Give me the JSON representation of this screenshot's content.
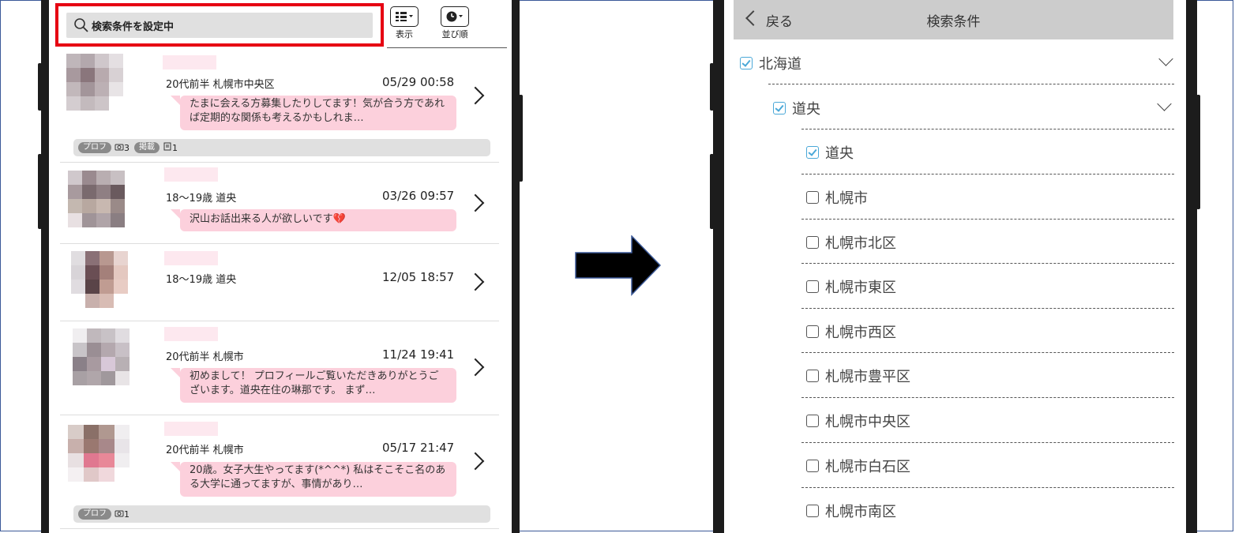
{
  "left": {
    "search_text": "検索条件を設定中",
    "display_label": "表示",
    "sort_label": "並び順",
    "rows": [
      {
        "meta": "20代前半 札幌市中央区",
        "time": "05/29 00:58",
        "message": "たまに会える方募集したりしてます！気が合う方であれば定期的な関係も考えるかもしれま…",
        "tags": {
          "prof": "プロフ",
          "photos": "3",
          "keisai": "掲載",
          "keisai_count": "1"
        }
      },
      {
        "meta": "18〜19歳 道央",
        "time": "03/26 09:57",
        "message": "沢山お話出来る人が欲しいです💔"
      },
      {
        "meta": "18〜19歳 道央",
        "time": "12/05 18:57"
      },
      {
        "meta": "20代前半 札幌市",
        "time": "11/24 19:41",
        "message": "初めまして！ プロフィールご覧いただきありがとうございます。道央在住の琳那です。 まず…"
      },
      {
        "meta": "20代前半 札幌市",
        "time": "05/17 21:47",
        "message": "20歳。女子大生やってます(*^^*) 私はそこそこ名のある大学に通ってますが、事情があり…",
        "tags": {
          "prof": "プロフ",
          "photos": "1"
        }
      }
    ]
  },
  "right": {
    "back_label": "戻る",
    "title": "検索条件",
    "items": [
      {
        "label": "北海道",
        "checked": true
      },
      {
        "label": "道央",
        "checked": true
      },
      {
        "label": "道央",
        "checked": true
      },
      {
        "label": "札幌市",
        "checked": false
      },
      {
        "label": "札幌市北区",
        "checked": false
      },
      {
        "label": "札幌市東区",
        "checked": false
      },
      {
        "label": "札幌市西区",
        "checked": false
      },
      {
        "label": "札幌市豊平区",
        "checked": false
      },
      {
        "label": "札幌市中央区",
        "checked": false
      },
      {
        "label": "札幌市白石区",
        "checked": false
      },
      {
        "label": "札幌市南区",
        "checked": false
      }
    ]
  },
  "colors": {
    "highlight": "#e60012",
    "bubble": "#fcd0dc",
    "checkbox_checked": "#4aa8d8",
    "header_bg": "#cccccc"
  }
}
